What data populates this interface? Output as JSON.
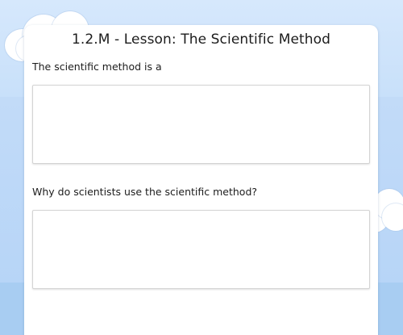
{
  "lesson": {
    "title": "1.2.M - Lesson: The Scientific Method"
  },
  "questions": [
    {
      "prompt": "The scientific method is a",
      "answer_value": ""
    },
    {
      "prompt": "Why do scientists use the scientific method?",
      "answer_value": ""
    }
  ],
  "theme": {
    "sky_top": "#d6e8fc",
    "sky_bottom": "#a8cdf2",
    "card_bg": "#ffffff",
    "text_color": "#1c1c1c"
  }
}
